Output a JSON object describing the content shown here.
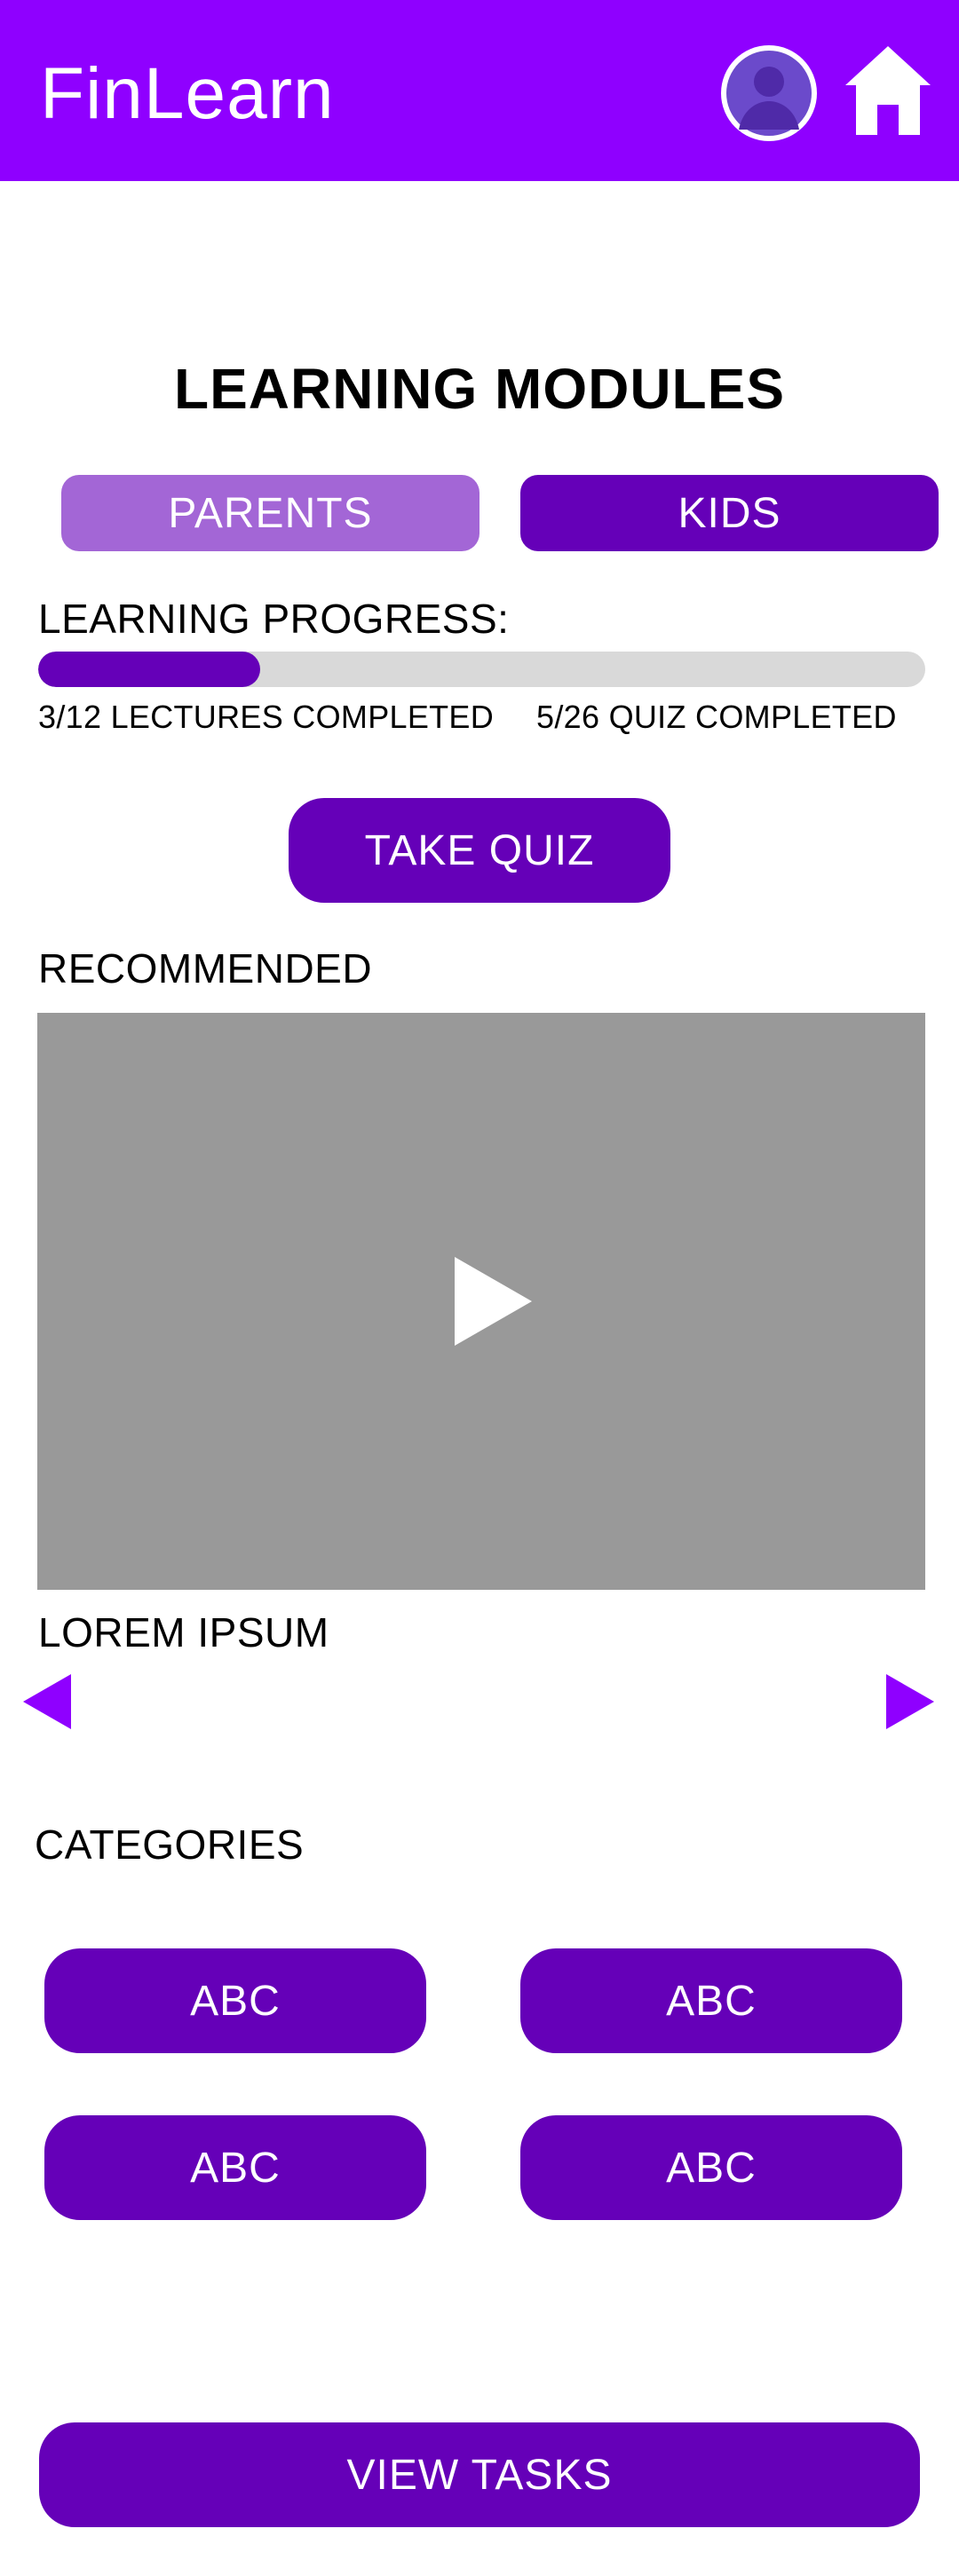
{
  "app": {
    "title": "FinLearn",
    "header_color": "#8f00ff",
    "profile_icon": "user-avatar-icon",
    "home_icon": "home-icon"
  },
  "main": {
    "title": "LEARNING MODULES",
    "audience_tabs": [
      {
        "label": "PARENTS",
        "color": "#a366d6"
      },
      {
        "label": "KIDS",
        "color": "#6500b8"
      }
    ],
    "progress": {
      "label": "LEARNING PROGRESS:",
      "fraction": 0.25,
      "lectures_text": "3/12 LECTURES COMPLETED",
      "quiz_text": "5/26 QUIZ COMPLETED"
    },
    "take_quiz_label": "TAKE QUIZ"
  },
  "recommended": {
    "heading": "RECOMMENDED",
    "video_title": "LOREM IPSUM",
    "play_icon": "play-icon",
    "prev_icon": "left-triangle-icon",
    "next_icon": "right-triangle-icon"
  },
  "categories": {
    "heading": "CATEGORIES",
    "items": [
      {
        "label": "ABC"
      },
      {
        "label": "ABC"
      },
      {
        "label": "ABC"
      },
      {
        "label": "ABC"
      }
    ]
  },
  "footer": {
    "view_tasks_label": "VIEW TASKS"
  },
  "colors": {
    "primary": "#6500b8",
    "accent": "#8f00ff",
    "video_placeholder": "#999999",
    "track": "#d9d9d9"
  }
}
